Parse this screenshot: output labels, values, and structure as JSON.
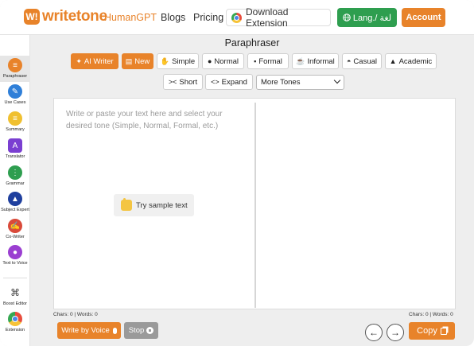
{
  "header": {
    "logo_mark": "W!",
    "logo_text": "writetone",
    "nav": {
      "humangpt": "HumanGPT",
      "blogs": "Blogs",
      "pricing": "Pricing"
    },
    "download_extension": "Download Extension",
    "language": "Lang./ لغة",
    "account": "Account"
  },
  "sidebar": {
    "items": [
      {
        "label": "Paraphraser",
        "icon": "paraphraser-icon",
        "color": "#e8832a"
      },
      {
        "label": "Use Cases",
        "icon": "pen-icon",
        "color": "#2f7fd8"
      },
      {
        "label": "Summary",
        "icon": "summary-icon",
        "color": "#f0c030"
      },
      {
        "label": "Translator",
        "icon": "translate-icon",
        "color": "#7a3fd1"
      },
      {
        "label": "Grammar",
        "icon": "grammar-icon",
        "color": "#2e9e4f"
      },
      {
        "label": "Subject Expert",
        "icon": "graduation-cap-icon",
        "color": "#1f3f9e"
      },
      {
        "label": "Co-Writer",
        "icon": "co-writer-icon",
        "color": "#d94a3a"
      },
      {
        "label": "Text to Voice",
        "icon": "voice-icon",
        "color": "#9b3fd1"
      },
      {
        "label": "Boost Editor",
        "icon": "boost-editor-icon",
        "color": "#555555"
      },
      {
        "label": "Extension",
        "icon": "chrome-icon",
        "color": "#4a86e8"
      }
    ]
  },
  "main": {
    "title": "Paraphraser",
    "actions": {
      "ai_writer": "AI Writer",
      "new": "New"
    },
    "tones": [
      "Simple",
      "Normal",
      "Formal",
      "Informal",
      "Casual",
      "Academic"
    ],
    "length": {
      "short": "Short",
      "expand": "Expand"
    },
    "more_tones": "More Tones",
    "editor": {
      "placeholder": "Write or paste your text here and select your desired tone (Simple, Normal, Formal, etc.)",
      "sample": "Try sample text"
    },
    "counts_left": "Chars: 0 | Words: 0",
    "counts_right": "Chars: 0 | Words: 0",
    "write_by_voice": "Write by Voice",
    "stop": "Stop",
    "copy": "Copy"
  }
}
